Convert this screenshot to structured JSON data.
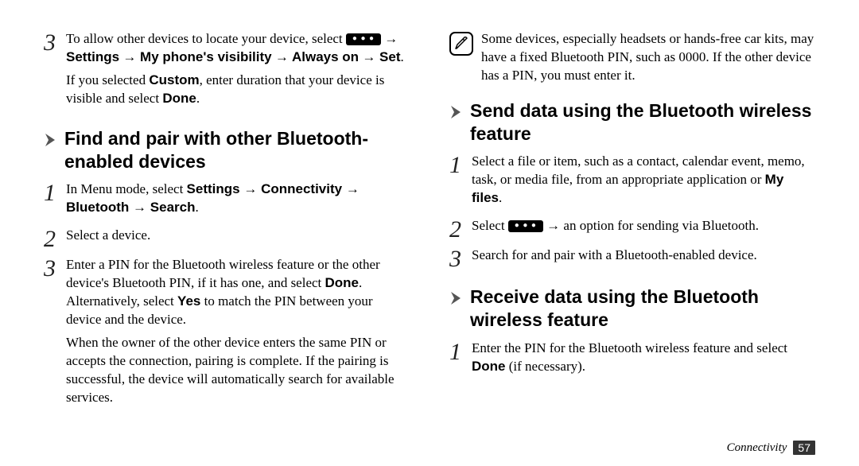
{
  "left": {
    "step3": {
      "num": "3",
      "intro": "To allow other devices to locate your device, select ",
      "path_settings": "Settings",
      "path_visibility": "My phone's visibility",
      "path_always_on": "Always on",
      "path_set": "Set",
      "custom_a": "If you selected ",
      "custom_b": "Custom",
      "custom_c": ", enter duration that your device is visible and select ",
      "custom_d": "Done",
      "custom_e": "."
    },
    "h1": "Find and pair with other Bluetooth-enabled devices",
    "s1": {
      "num": "1",
      "a": "In Menu mode, select ",
      "b": "Settings",
      "c": "Connectivity",
      "d": "Bluetooth",
      "e": "Search",
      "f": "."
    },
    "s2": {
      "num": "2",
      "text": "Select a device."
    },
    "s3": {
      "num": "3",
      "p1a": "Enter a PIN for the Bluetooth wireless feature or the other device's Bluetooth PIN, if it has one, and select ",
      "p1b": "Done",
      "p1c": ". Alternatively, select ",
      "p1d": "Yes",
      "p1e": " to match the PIN between your device and the device.",
      "p2": "When the owner of the other device enters the same PIN or accepts the connection, pairing is complete. If the pairing is successful, the device will automatically search for available services."
    }
  },
  "right": {
    "note": "Some devices, especially headsets or hands-free car kits, may have a fixed Bluetooth PIN, such as 0000. If the other device has a PIN, you must enter it.",
    "h_send": "Send data using the Bluetooth wireless feature",
    "send1": {
      "num": "1",
      "a": "Select a file or item, such as a contact, calendar event, memo, task, or media file, from an appropriate application or ",
      "b": "My files",
      "c": "."
    },
    "send2": {
      "num": "2",
      "a": "Select ",
      "b": " → an option for sending via Bluetooth."
    },
    "send3": {
      "num": "3",
      "text": "Search for and pair with a Bluetooth-enabled device."
    },
    "h_recv": "Receive data using the Bluetooth wireless feature",
    "recv1": {
      "num": "1",
      "a": "Enter the PIN for the Bluetooth wireless feature and select ",
      "b": "Done",
      "c": " (if necessary)."
    }
  },
  "footer": {
    "section": "Connectivity",
    "page": "57"
  }
}
